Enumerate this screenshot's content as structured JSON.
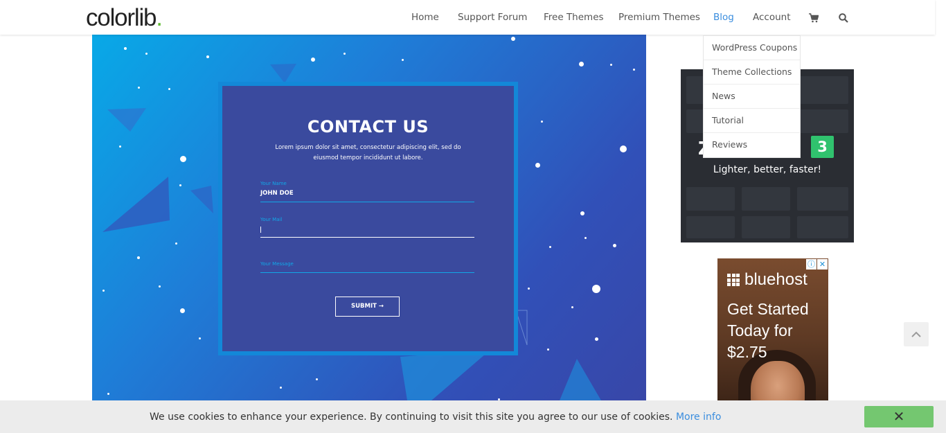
{
  "header": {
    "logo_text": "colorlib",
    "logo_dot": ".",
    "nav": [
      {
        "label": "Home"
      },
      {
        "label": "Support Forum"
      },
      {
        "label": "Free Themes"
      },
      {
        "label": "Premium Themes"
      },
      {
        "label": "Blog",
        "active": true
      },
      {
        "label": "Account"
      }
    ],
    "icons": [
      "cart-icon",
      "search-icon"
    ]
  },
  "blog_dropdown": {
    "items": [
      {
        "label": "WordPress Coupons"
      },
      {
        "label": "Theme Collections"
      },
      {
        "label": "News"
      },
      {
        "label": "Tutorial"
      },
      {
        "label": "Reviews"
      }
    ]
  },
  "hero_form": {
    "title": "CONTACT US",
    "subtitle_line1": "Lorem ipsum dolor sit amet, consectetur adipiscing elit, sed do",
    "subtitle_line2": "eiusmod tempor incididunt ut labore.",
    "fields": [
      {
        "label": "Your Name",
        "value": "JOHN DOE"
      },
      {
        "label": "Your Mail",
        "value": ""
      },
      {
        "label": "Your Message",
        "value": ""
      }
    ],
    "submit_label": "SUBMIT →"
  },
  "sidebar_ad1": {
    "title": "Z",
    "badge": "3",
    "tagline": "Lighter, better, faster!"
  },
  "sidebar_ad2": {
    "brand": "bluehost",
    "headline": "Get Started Today for $2.75",
    "adchoices_info": "ⓘ",
    "adchoices_close": "✕"
  },
  "cookie_bar": {
    "text": "We use cookies to enhance your experience. By continuing to visit this site you agree to our use of cookies.",
    "link_text": "More info",
    "close_label": "✕"
  },
  "colors": {
    "accent": "#3a8dde",
    "logo_dot": "#5dbb2f",
    "form_field": "#12a8e8",
    "cookie_close": "#74c770"
  }
}
